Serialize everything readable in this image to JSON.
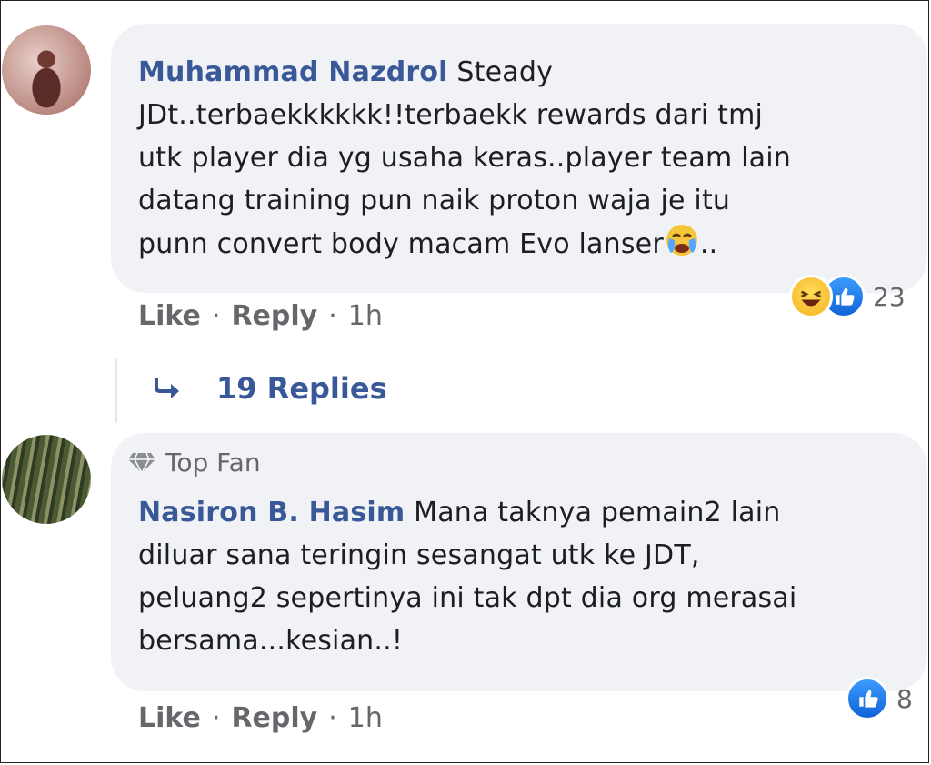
{
  "comments": [
    {
      "author": "Muhammad Nazdrol",
      "lines": [
        "Steady",
        "JDt..terbaekkkkkk!!terbaekk rewards dari tmj",
        "utk player dia yg usaha keras..player team lain",
        "datang training pun naik proton waja je itu",
        "punn convert body macam Evo lanser"
      ],
      "line_tail": "..",
      "reaction_count": "23",
      "actions": {
        "like": "Like",
        "reply": "Reply",
        "time": "1h",
        "sep": "·"
      },
      "replies_label": "19 Replies"
    },
    {
      "badge": "Top Fan",
      "author": "Nasiron B. Hasim",
      "lines": [
        "Mana taknya pemain2 lain",
        "diluar sana teringin sesangat utk ke JDT,",
        "peluang2 sepertinya ini tak dpt dia org merasai",
        "bersama...kesian..!"
      ],
      "reaction_count": "8",
      "actions": {
        "like": "Like",
        "reply": "Reply",
        "time": "1h",
        "sep": "·"
      }
    }
  ],
  "icons": {
    "reply_arrow": "reply-arrow-icon",
    "top_fan": "diamond-icon",
    "reaction_haha": "haha-reaction-icon",
    "reaction_like": "like-reaction-icon",
    "crying_emoji": "crying-face-emoji"
  },
  "colors": {
    "name": "#385898",
    "bubble": "#f0f2f5",
    "muted": "#65676b",
    "like_blue": "#1877f2"
  }
}
